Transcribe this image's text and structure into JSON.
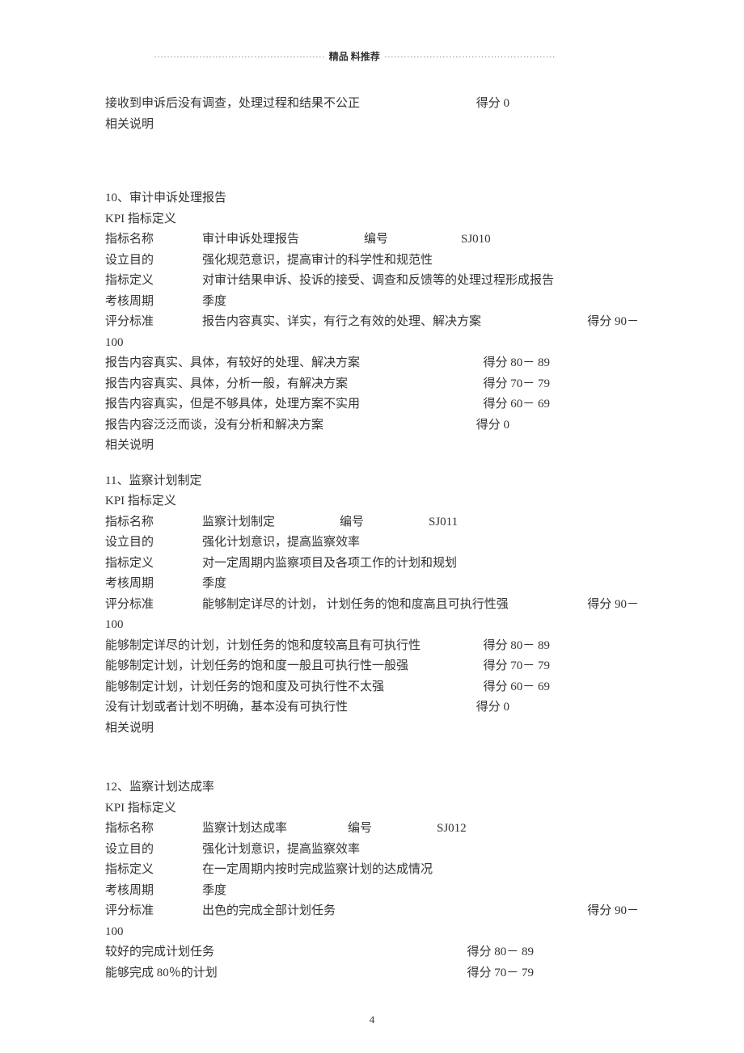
{
  "header": {
    "label": "精品  料推荐",
    "dots_left": "·····················································",
    "dots_right": "·····················································"
  },
  "intro": {
    "line1_desc": "接收到申诉后没有调查，处理过程和结果不公正",
    "line1_score": "得分 0",
    "line2": "相关说明"
  },
  "sec10": {
    "title": "10、审计申诉处理报告",
    "kpi": "KPI 指标定义",
    "name_label": "指标名称",
    "name_value": "审计申诉处理报告",
    "code_label": "编号",
    "code_value": "SJ010",
    "purpose_label": "设立目的",
    "purpose_value": "强化规范意识，提高审计的科学性和规范性",
    "def_label": "指标定义",
    "def_value": "对审计结果申诉、投诉的接受、调查和反馈等的处理过程形成报告",
    "cycle_label": "考核周期",
    "cycle_value": "季度",
    "std_label": "评分标准",
    "std_value": "报告内容真实、详实，有行之有效的处理、解决方案",
    "std_score": "得分  90－",
    "hundred": "100",
    "rows": [
      {
        "d": "报告内容真实、具体，有较好的处理、解决方案",
        "s": "得分 80－ 89"
      },
      {
        "d": "报告内容真实、具体，分析一般，有解决方案",
        "s": "得分 70－ 79"
      },
      {
        "d": "报告内容真实，但是不够具体，处理方案不实用",
        "s": "得分 60－ 69"
      },
      {
        "d": "报告内容泛泛而谈，没有分析和解决方案",
        "s": "得分 0"
      }
    ],
    "note": "相关说明"
  },
  "sec11": {
    "title": "11、监察计划制定",
    "kpi": "KPI 指标定义",
    "name_label": "指标名称",
    "name_value": "监察计划制定",
    "code_label": "编号",
    "code_value": "SJ011",
    "purpose_label": "设立目的",
    "purpose_value": "强化计划意识，提高监察效率",
    "def_label": "指标定义",
    "def_value": "对一定周期内监察项目及各项工作的计划和规划",
    "cycle_label": "考核周期",
    "cycle_value": "季度",
    "std_label": "评分标准",
    "std_value": "能够制定详尽的计划，   计划任务的饱和度高且可执行性强",
    "std_score": "得分 90－",
    "hundred": "100",
    "rows": [
      {
        "d": "能够制定详尽的计划，计划任务的饱和度较高且有可执行性",
        "s": "得分 80－ 89"
      },
      {
        "d": "能够制定计划，计划任务的饱和度一般且可执行性一般强",
        "s": "得分 70－ 79"
      },
      {
        "d": "能够制定计划，计划任务的饱和度及可执行性不太强",
        "s": "得分 60－ 69"
      },
      {
        "d": "没有计划或者计划不明确，基本没有可执行性",
        "s": "得分 0"
      }
    ],
    "note": "相关说明"
  },
  "sec12": {
    "title": "12、监察计划达成率",
    "kpi": "KPI 指标定义",
    "name_label": "指标名称",
    "name_value": "监察计划达成率",
    "code_label": "编号",
    "code_value": "SJ012",
    "purpose_label": "设立目的",
    "purpose_value": "强化计划意识，提高监察效率",
    "def_label": "指标定义",
    "def_value": "在一定周期内按时完成监察计划的达成情况",
    "cycle_label": "考核周期",
    "cycle_value": "季度",
    "std_label": "评分标准",
    "std_value": "出色的完成全部计划任务",
    "std_score": "得分  90－",
    "hundred": "100",
    "rows": [
      {
        "d": "较好的完成计划任务",
        "s": "得分 80－ 89"
      },
      {
        "d": "能够完成  80％的计划",
        "s": "得分 70－ 79"
      }
    ]
  },
  "page_number": "4"
}
